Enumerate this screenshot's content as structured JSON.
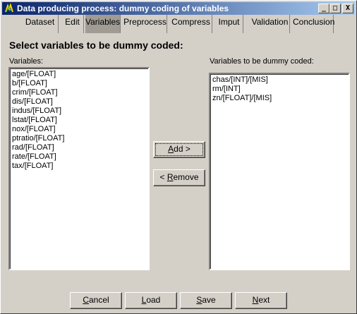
{
  "window": {
    "title": "Data producing process: dummy coding of variables",
    "controls": {
      "minimize": "_",
      "maximize": "□",
      "close": "X"
    }
  },
  "tabs": [
    {
      "label": "Dataset",
      "active": false
    },
    {
      "label": "Edit",
      "active": false
    },
    {
      "label": "Variables",
      "active": true
    },
    {
      "label": "Preprocess",
      "active": false
    },
    {
      "label": "Compress",
      "active": false
    },
    {
      "label": "Imput",
      "active": false
    },
    {
      "label": "Validation",
      "active": false
    },
    {
      "label": "Conclusion",
      "active": false
    }
  ],
  "heading": "Select variables to be dummy coded:",
  "left_list": {
    "label": "Variables:",
    "items": [
      "age/[FLOAT]",
      "b/[FLOAT]",
      "crim/[FLOAT]",
      "dis/[FLOAT]",
      "indus/[FLOAT]",
      "lstat/[FLOAT]",
      "nox/[FLOAT]",
      "ptratio/[FLOAT]",
      "rad/[FLOAT]",
      "rate/[FLOAT]",
      "tax/[FLOAT]"
    ]
  },
  "right_list": {
    "label": "Variables to be dummy coded:",
    "items": [
      "chas/[INT]/[MIS]",
      "rm/[INT]",
      "zn/[FLOAT]/[MIS]"
    ]
  },
  "buttons": {
    "add": {
      "mnemonic": "A",
      "rest": "dd >"
    },
    "remove": {
      "prefix": "< ",
      "mnemonic": "R",
      "rest": "emove"
    },
    "cancel": {
      "mnemonic": "C",
      "rest": "ancel"
    },
    "load": {
      "mnemonic": "L",
      "rest": "oad"
    },
    "save": {
      "mnemonic": "S",
      "rest": "ave"
    },
    "next": {
      "mnemonic": "N",
      "rest": "ext"
    }
  },
  "colors": {
    "face": "#d4d0c8",
    "title_start": "#0a246a",
    "title_end": "#a6caf0",
    "active_tab": "#a09c94"
  }
}
